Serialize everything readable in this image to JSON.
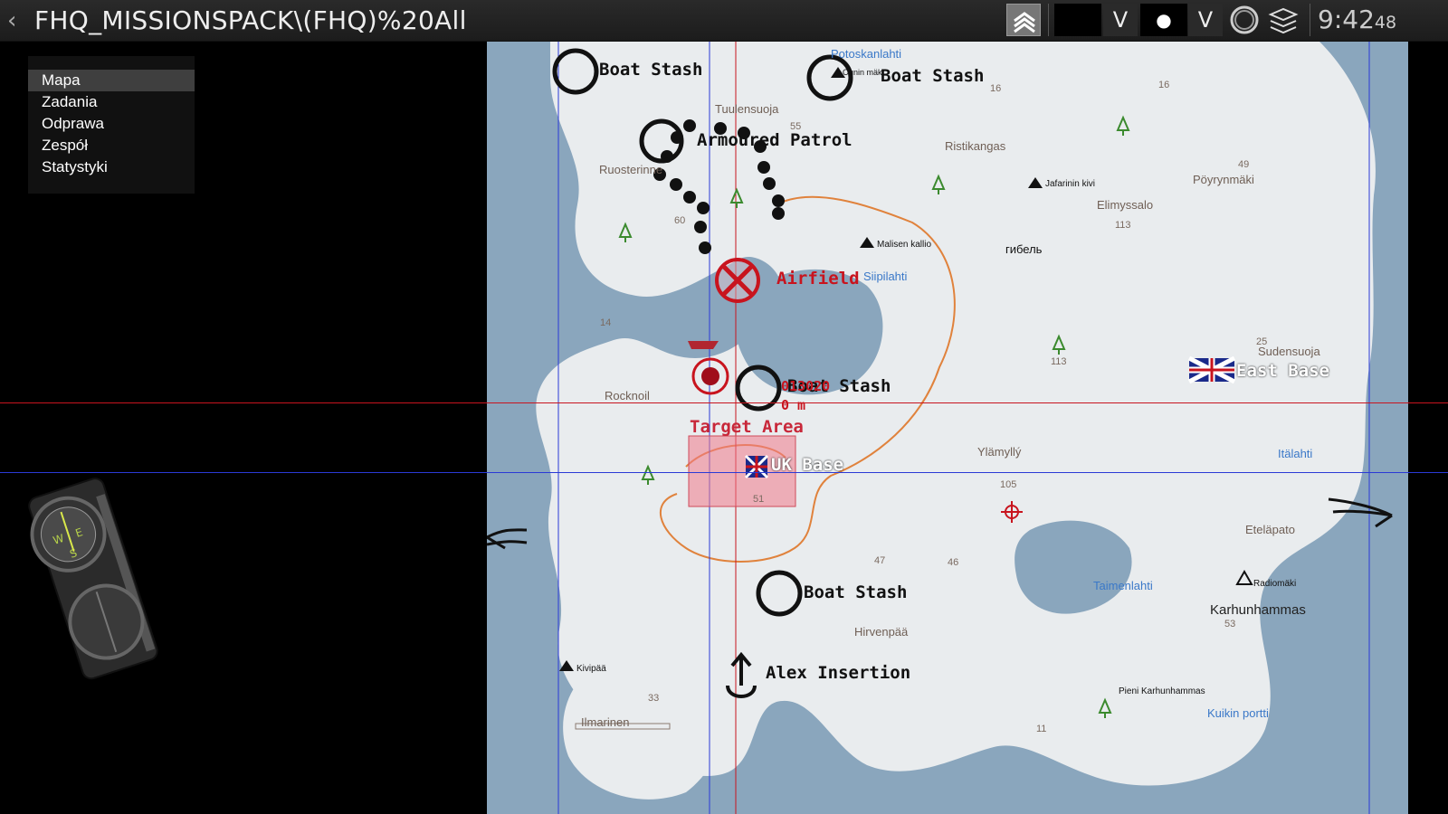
{
  "topbar": {
    "back_glyph": "‹",
    "mission_title": "FHQ_MISSIONSPACK\\(FHQ)%20All",
    "dropdown_glyph_1": "V",
    "marker_glyph": "●",
    "dropdown_glyph_2": "V",
    "clock_main": "9:42",
    "clock_seconds": "48",
    "icons": [
      "rank-chevrons-icon",
      "gps-circle-icon",
      "layers-icon"
    ]
  },
  "menu": {
    "items": [
      "Mapa",
      "Zadania",
      "Odprawa",
      "Zespół",
      "Statystyki"
    ],
    "active": "Mapa"
  },
  "map": {
    "place_labels": [
      "Ruosterinne",
      "Tuulensuoja",
      "Ristikangas",
      "Pöyrynmäki",
      "Elimyssalo",
      "Rocknoil",
      "Ylämyllý",
      "Sudensuoja",
      "Eteläpato",
      "Hirvenpää",
      "Karhunhammas",
      "Ilmarinen",
      "Jafarinin kivi",
      "Malisen kallio",
      "Kivipää",
      "Radiomäki",
      "Pieni Karhunhammas",
      "гибель",
      "Ounin mäki"
    ],
    "water_labels": [
      "Potoskanlahti",
      "Siipilahti",
      "Itälahti",
      "Taimenlahti",
      "Kuikin portti"
    ],
    "elevations": [
      "55",
      "16",
      "16",
      "49",
      "113",
      "60",
      "14",
      "113",
      "25",
      "105",
      "47",
      "46",
      "53",
      "33",
      "11",
      "51"
    ],
    "markers": {
      "boat_stash": "Boat Stash",
      "armoured_patrol": "Armoured Patrol",
      "airfield": "Airfield",
      "east_base": "East Base",
      "uk_base": "UK Base",
      "target_area": "Target Area",
      "alex_insertion": "Alex Insertion",
      "cursor_grid": "013020",
      "cursor_distance": "0 m"
    }
  },
  "colors": {
    "land": "#e9ecee",
    "water": "#8aa6bd",
    "road": "#e0823c",
    "red_marker": "#c8141e",
    "blue_line": "#2a3ad6"
  }
}
